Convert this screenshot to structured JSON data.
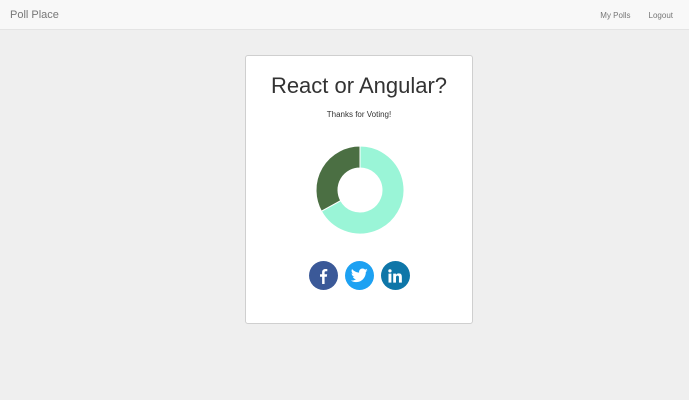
{
  "navbar": {
    "brand": "Poll Place",
    "links": [
      {
        "label": "My Polls"
      },
      {
        "label": "Logout"
      }
    ]
  },
  "poll": {
    "question": "React or Angular?",
    "message": "Thanks for Voting!"
  },
  "colors": {
    "slice_1": "#9af5d7",
    "slice_2": "#4b6f43",
    "facebook": "#3b5998",
    "twitter": "#1da1f2",
    "linkedin": "#0e76a8"
  },
  "chart_data": {
    "type": "pie",
    "values": [
      67,
      33
    ]
  },
  "social": [
    {
      "icon": "facebook-icon"
    },
    {
      "icon": "twitter-icon"
    },
    {
      "icon": "linkedin-icon"
    }
  ]
}
